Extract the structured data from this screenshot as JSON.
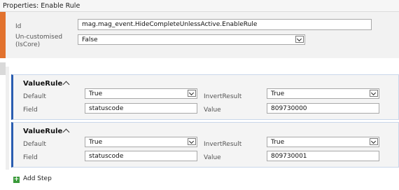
{
  "window": {
    "title": "Properties: Enable Rule"
  },
  "properties": {
    "id_label": "Id",
    "id_value": "mag.mag_event.HideCompleteUnlessActive.EnableRule",
    "iscore_label_line1": "Un-customised",
    "iscore_label_line2": "(IsCore)",
    "iscore_value": "False"
  },
  "rules": [
    {
      "header": "ValueRule",
      "default_label": "Default",
      "default_value": "True",
      "invert_label": "InvertResult",
      "invert_value": "True",
      "field_label": "Field",
      "field_value": "statuscode",
      "value_label": "Value",
      "value_value": "809730000"
    },
    {
      "header": "ValueRule",
      "default_label": "Default",
      "default_value": "True",
      "invert_label": "InvertResult",
      "invert_value": "True",
      "field_label": "Field",
      "field_value": "statuscode",
      "value_label": "Value",
      "value_value": "809730001"
    }
  ],
  "add_step": {
    "label": "Add Step",
    "icon": "plus-icon"
  },
  "colors": {
    "accent_orange": "#e2722e",
    "rule_accent_blue": "#2a5db0",
    "add_icon_green": "#3a9a3a"
  }
}
